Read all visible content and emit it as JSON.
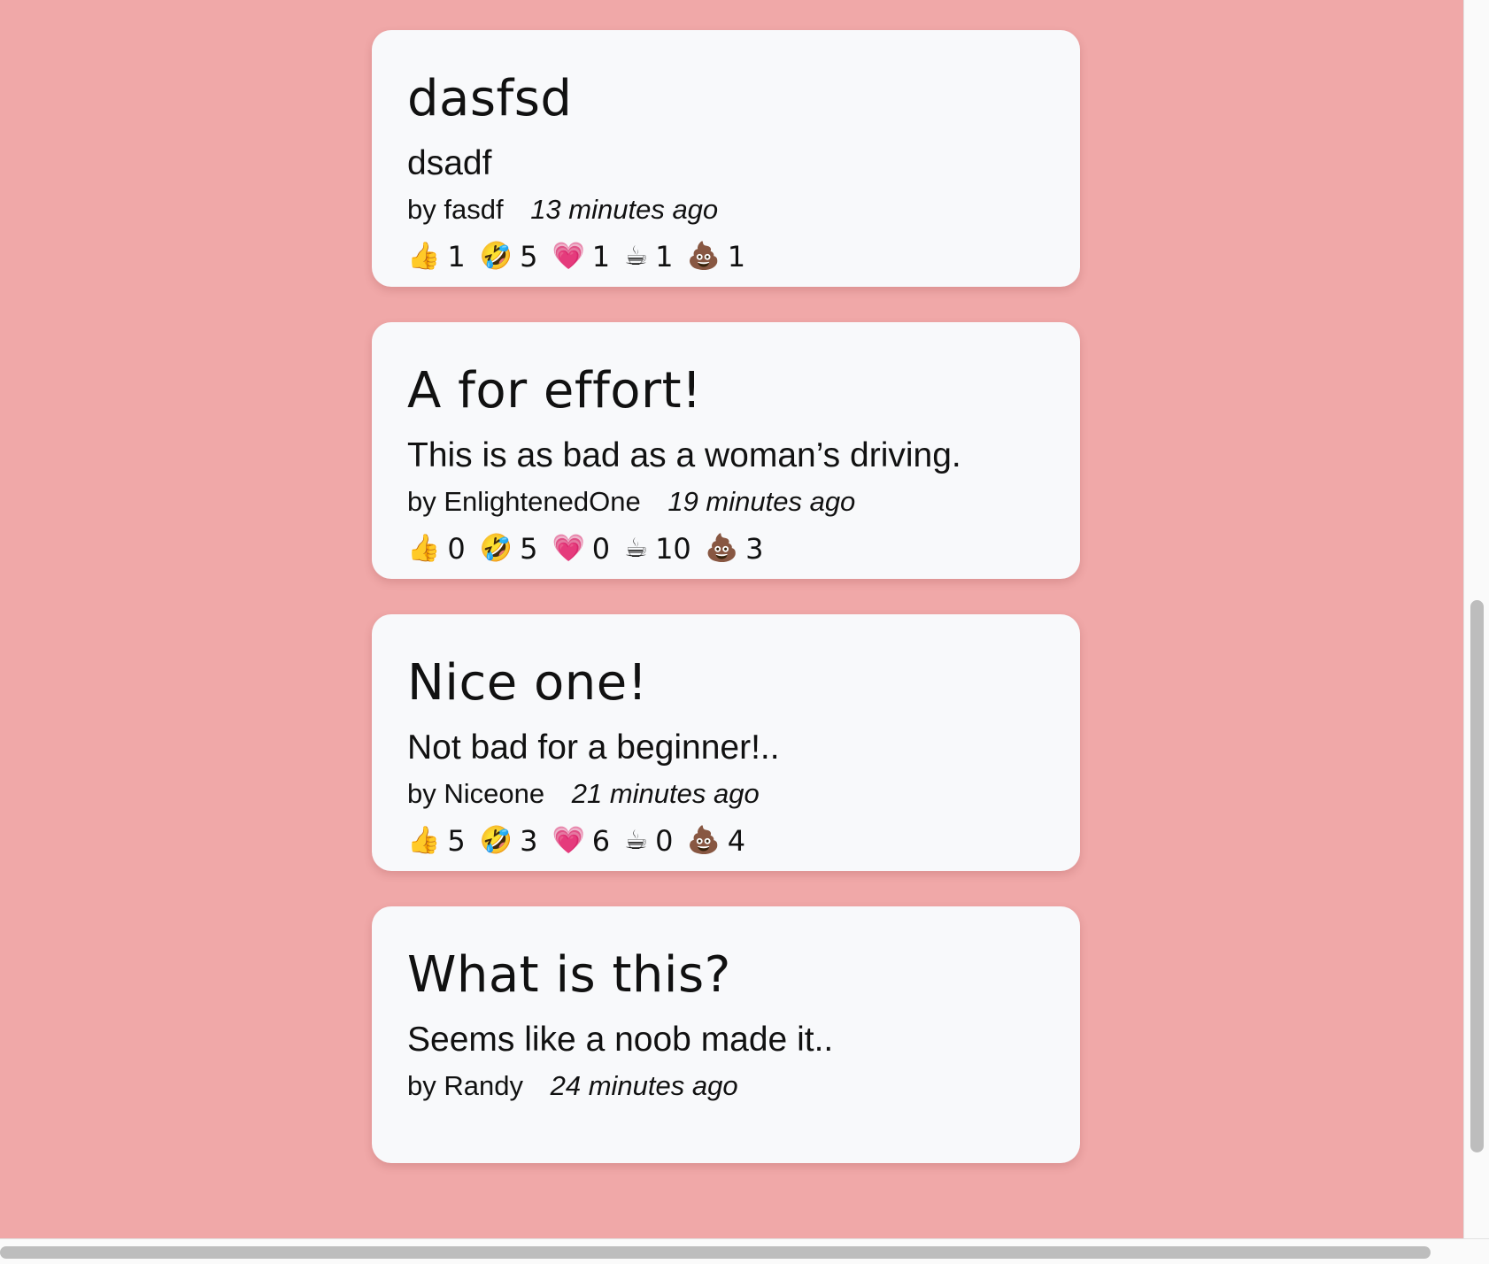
{
  "posts": [
    {
      "title": "dasfsd",
      "body": "dsadf",
      "author": "by fasdf",
      "time": "13 minutes ago",
      "reactions": [
        {
          "icon": "thumbs-up-icon",
          "emoji": "👍",
          "count": "1"
        },
        {
          "icon": "rofl-icon",
          "emoji": "🤣",
          "count": "5"
        },
        {
          "icon": "heart-icon",
          "emoji": "💗",
          "count": "1"
        },
        {
          "icon": "coffee-icon",
          "emoji": "☕",
          "count": "1"
        },
        {
          "icon": "poop-icon",
          "emoji": "💩",
          "count": "1"
        }
      ]
    },
    {
      "title": "A for effort!",
      "body": "This is as bad as a woman’s driving.",
      "author": "by EnlightenedOne",
      "time": "19 minutes ago",
      "reactions": [
        {
          "icon": "thumbs-up-icon",
          "emoji": "👍",
          "count": "0"
        },
        {
          "icon": "rofl-icon",
          "emoji": "🤣",
          "count": "5"
        },
        {
          "icon": "heart-icon",
          "emoji": "💗",
          "count": "0"
        },
        {
          "icon": "coffee-icon",
          "emoji": "☕",
          "count": "10"
        },
        {
          "icon": "poop-icon",
          "emoji": "💩",
          "count": "3"
        }
      ]
    },
    {
      "title": "Nice one!",
      "body": "Not bad for a beginner!..",
      "author": "by Niceone",
      "time": "21 minutes ago",
      "reactions": [
        {
          "icon": "thumbs-up-icon",
          "emoji": "👍",
          "count": "5"
        },
        {
          "icon": "rofl-icon",
          "emoji": "🤣",
          "count": "3"
        },
        {
          "icon": "heart-icon",
          "emoji": "💗",
          "count": "6"
        },
        {
          "icon": "coffee-icon",
          "emoji": "☕",
          "count": "0"
        },
        {
          "icon": "poop-icon",
          "emoji": "💩",
          "count": "4"
        }
      ]
    },
    {
      "title": "What is this?",
      "body": "Seems like a noob made it..",
      "author": "by Randy",
      "time": "24 minutes ago",
      "reactions": []
    }
  ],
  "colors": {
    "background": "#f0a8a8",
    "card": "#f8f9fb"
  }
}
